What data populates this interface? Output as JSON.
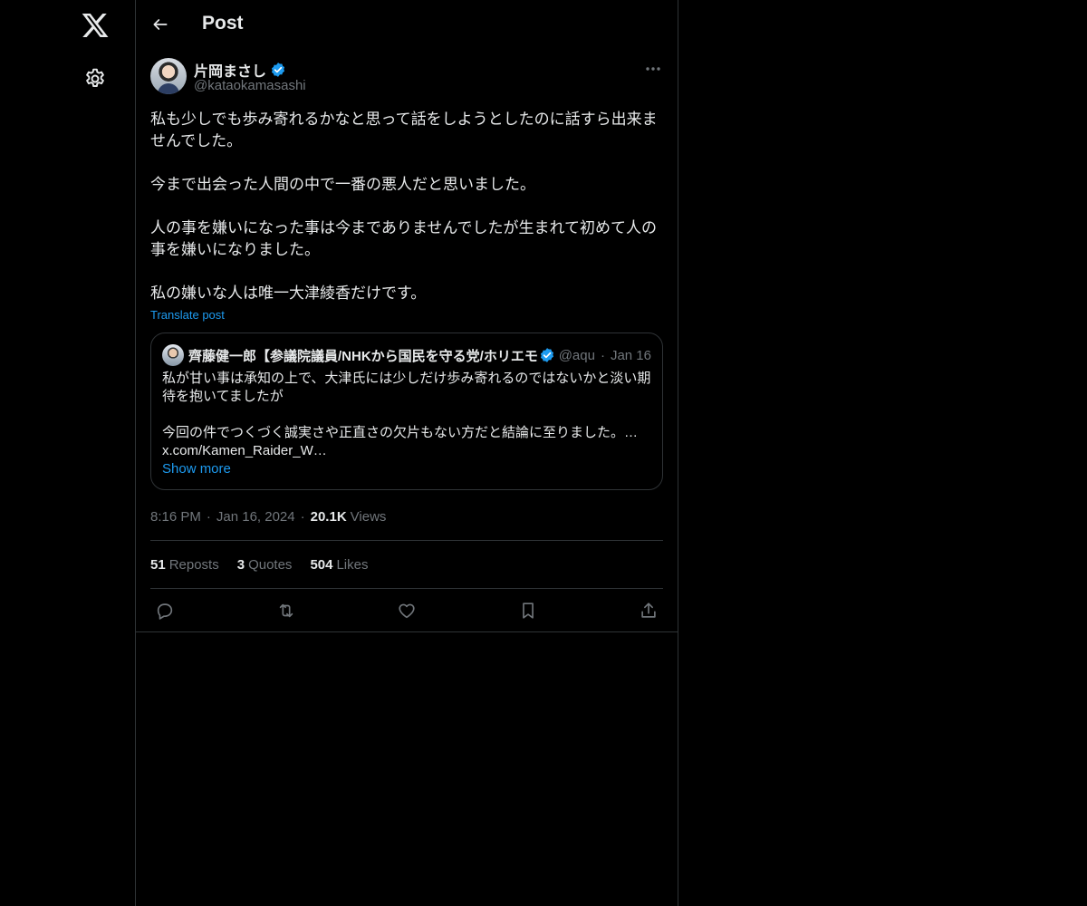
{
  "header": {
    "title": "Post",
    "back_icon": "arrow-left-icon"
  },
  "rail": {
    "logo_icon": "x-logo-icon",
    "settings_icon": "gear-icon"
  },
  "post": {
    "author": {
      "name": "片岡まさし",
      "handle": "@kataokamasashi",
      "verified": true
    },
    "text": "私も少しでも歩み寄れるかなと思って話をしようとしたのに話すら出来ませんでした。\n\n今まで出会った人間の中で一番の悪人だと思いました。\n\n人の事を嫌いになった事は今までありませんでしたが生まれて初めて人の事を嫌いになりました。\n\n私の嫌いな人は唯一大津綾香だけです。",
    "translate_label": "Translate post",
    "quote": {
      "name": "齊藤健一郎【参議院議員/NHKから国民を守る党/ホリエモ",
      "handle": "@aqu",
      "dot": "·",
      "date": "Jan 16",
      "text": "私が甘い事は承知の上で、大津氏には少しだけ歩み寄れるのではないかと淡い期待を抱いてましたが\n\n今回の件でつくづく誠実さや正直さの欠片もない方だと結論に至りました。…\nx.com/Kamen_Raider_W…",
      "show_more": "Show more"
    },
    "meta": {
      "time": "8:16 PM",
      "sep": "·",
      "date": "Jan 16, 2024",
      "views_count": "20.1K",
      "views_label": "Views"
    },
    "stats": {
      "reposts_count": "51",
      "reposts_label": "Reposts",
      "quotes_count": "3",
      "quotes_label": "Quotes",
      "likes_count": "504",
      "likes_label": "Likes"
    },
    "actions": [
      "reply-icon",
      "repost-icon",
      "like-icon",
      "bookmark-icon",
      "share-icon"
    ]
  },
  "colors": {
    "background": "#000000",
    "text": "#e7e9ea",
    "muted": "#71767b",
    "accent": "#1d9bf0",
    "border": "#2f3336"
  }
}
